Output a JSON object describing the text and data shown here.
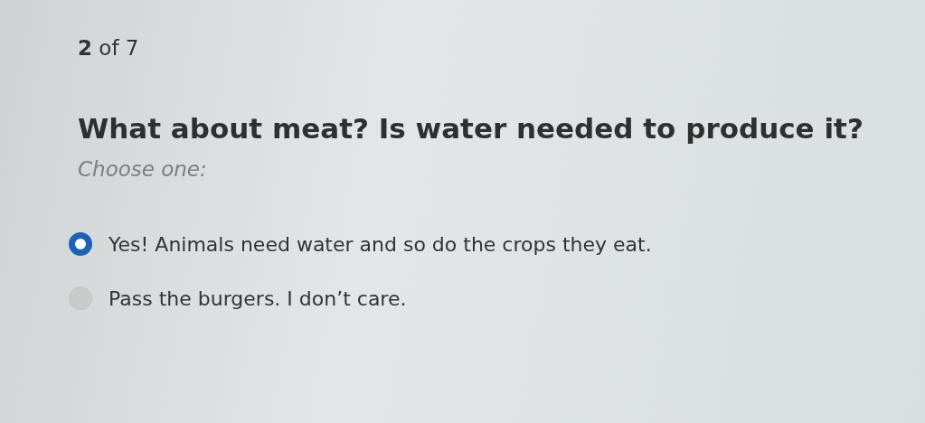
{
  "progress": {
    "current": "2",
    "total": "of 7"
  },
  "question": "What about meat? Is water needed to produce it?",
  "instruction": "Choose one:",
  "options": [
    {
      "label": "Yes! Animals need water and so do the crops they eat.",
      "selected": true
    },
    {
      "label": "Pass the burgers. I don’t care.",
      "selected": false
    }
  ]
}
